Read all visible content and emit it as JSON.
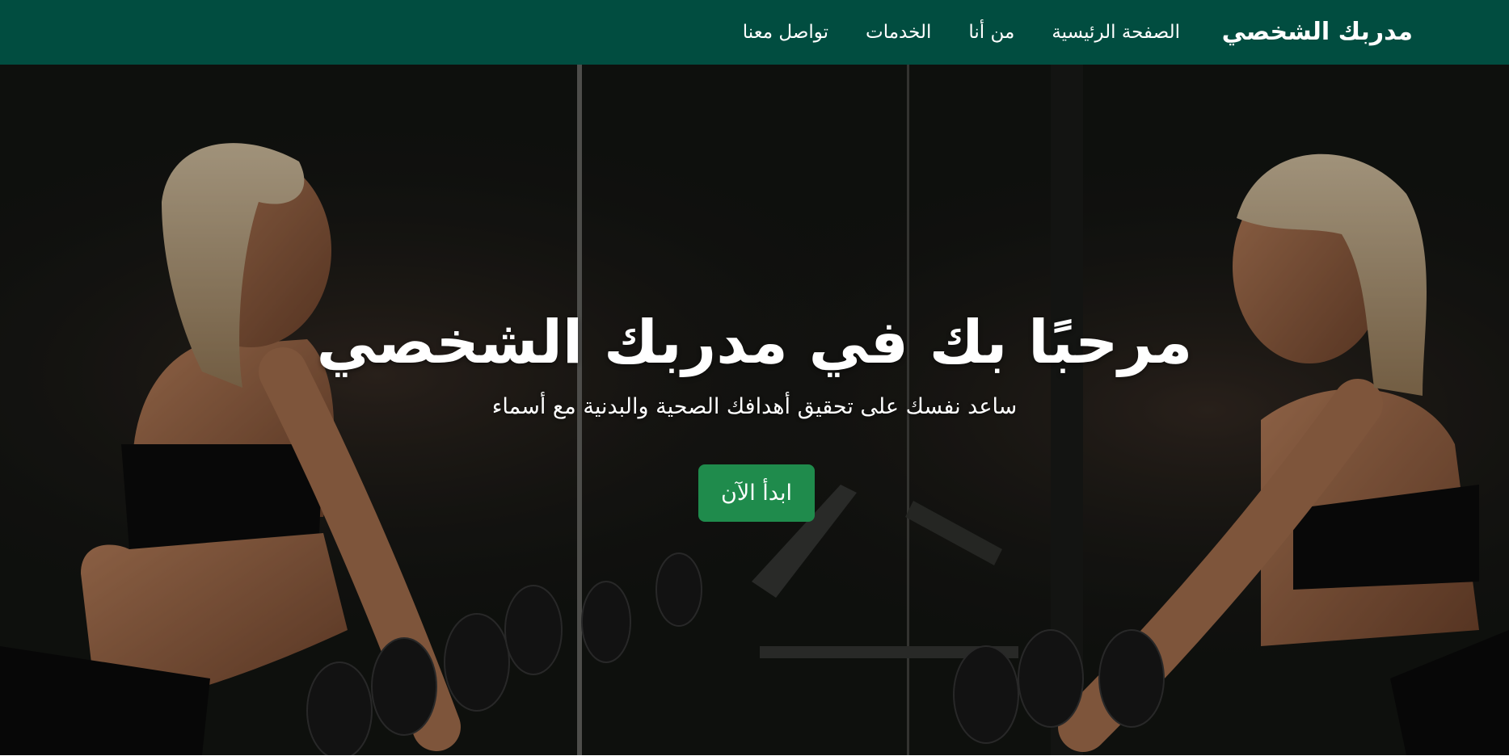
{
  "navbar": {
    "brand": "مدربك الشخصي",
    "links": [
      "الصفحة الرئيسية",
      "من أنا",
      "الخدمات",
      "تواصل معنا"
    ],
    "background_color": "#014d40"
  },
  "hero": {
    "title": "مرحبًا بك في مدربك الشخصي",
    "subtitle": "ساعد نفسك على تحقيق أهدافك الصحية والبدنية مع أسماء",
    "cta_label": "ابدأ الآن",
    "cta_color": "#1f8b4c"
  }
}
